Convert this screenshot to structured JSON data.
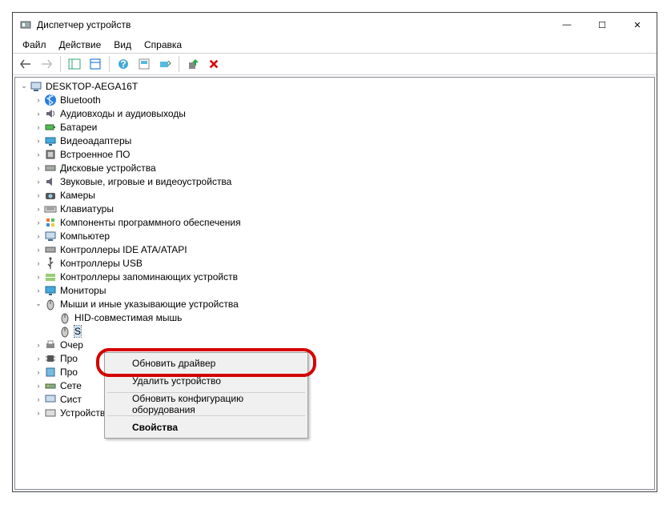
{
  "window": {
    "title": "Диспетчер устройств",
    "min": "—",
    "max": "☐",
    "close": "✕"
  },
  "menu": {
    "file": "Файл",
    "action": "Действие",
    "view": "Вид",
    "help": "Справка"
  },
  "tree": {
    "root": "DESKTOP-AEGA16T",
    "items": [
      "Bluetooth",
      "Аудиовходы и аудиовыходы",
      "Батареи",
      "Видеоадаптеры",
      "Встроенное ПО",
      "Дисковые устройства",
      "Звуковые, игровые и видеоустройства",
      "Камеры",
      "Клавиатуры",
      "Компоненты программного обеспечения",
      "Компьютер",
      "Контроллеры IDE ATA/ATAPI",
      "Контроллеры USB",
      "Контроллеры запоминающих устройств",
      "Мониторы"
    ],
    "mouse_cat": "Мыши и иные указывающие устройства",
    "mouse_child1": "HID-совместимая мышь",
    "mouse_child2": "S",
    "rest": [
      "Очер",
      "Про",
      "Про",
      "Сете",
      "Сист"
    ],
    "last": "Устройства HID (Human Interface Devices)"
  },
  "ctx": {
    "update": "Обновить драйвер",
    "remove": "Удалить устройство",
    "scan": "Обновить конфигурацию оборудования",
    "props": "Свойства"
  }
}
